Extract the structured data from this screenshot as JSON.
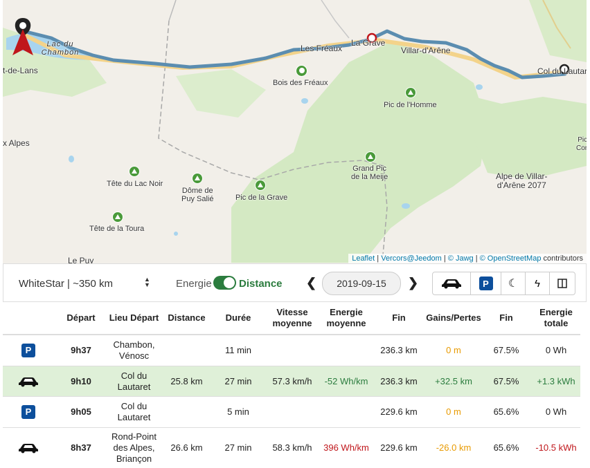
{
  "map": {
    "towns": {
      "chambon": "Lac du Chambon",
      "lans": "t-de-Lans",
      "lesfreaux": "Les Fréaux",
      "lagrave": "La Grave",
      "villar": "Villar-d'Arêne",
      "col": "Col du Lautar",
      "alpes": "x Alpes",
      "lepuy": "Le Puy",
      "picright": "Pic\nCon"
    },
    "peaks": {
      "bois": "Bois des Fréaux",
      "homme": "Pic de l'Homme",
      "meije": "Grand Pic\nde la Meije",
      "lacnoir": "Tête du Lac Noir",
      "puysalie": "Dôme de\nPuy Salié",
      "grave": "Pic de la Grave",
      "toura": "Tête de la Toura",
      "alpe": "Alpe de Villar-\nd'Arêne 2077"
    },
    "attribution": {
      "leaflet": "Leaflet",
      "vercors": "Vercors@Jeedom",
      "jawg": "© Jawg",
      "osm": "© OpenStreetMap",
      "contributors": "contributors"
    }
  },
  "controls": {
    "vehicle": "WhiteStar | ~350 km",
    "energie_label": "Energie",
    "distance_label": "Distance",
    "date": "2019-09-15",
    "buttons": [
      "car-icon",
      "parking-icon",
      "moon-icon",
      "bolt-icon",
      "columns-icon"
    ]
  },
  "table": {
    "headers": [
      "",
      "Départ",
      "Lieu Départ",
      "Distance",
      "Durée",
      "Vitesse moyenne",
      "Energie moyenne",
      "Fin",
      "Gains/Pertes",
      "Fin",
      "Energie totale"
    ],
    "rows": [
      {
        "type": "parking",
        "depart": "9h37",
        "lieu": "Chambon, Vénosc",
        "distance": "",
        "duree": "11 min",
        "vitesse": "",
        "energie": "",
        "fin": "236.3 km",
        "gains": "0 m",
        "fin2": "67.5%",
        "total": "0 Wh"
      },
      {
        "type": "drive",
        "depart": "9h10",
        "lieu": "Col du Lautaret",
        "distance": "25.8 km",
        "duree": "27 min",
        "vitesse": "57.3 km/h",
        "energie": "-52 Wh/km",
        "fin": "236.3 km",
        "gains": "+32.5 km",
        "fin2": "67.5%",
        "total": "+1.3 kWh"
      },
      {
        "type": "parking",
        "depart": "9h05",
        "lieu": "Col du Lautaret",
        "distance": "",
        "duree": "5 min",
        "vitesse": "",
        "energie": "",
        "fin": "229.6 km",
        "gains": "0 m",
        "fin2": "65.6%",
        "total": "0 Wh"
      },
      {
        "type": "drive",
        "depart": "8h37",
        "lieu": "Rond-Point des Alpes, Briançon",
        "distance": "26.6 km",
        "duree": "27 min",
        "vitesse": "58.3 km/h",
        "energie": "396 Wh/km",
        "fin": "229.6 km",
        "gains": "-26.0 km",
        "fin2": "65.6%",
        "total": "-10.5 kWh"
      }
    ]
  },
  "colors": {
    "accent_green": "#2b7c3e",
    "parking_blue": "#0d4f9c",
    "route": "#5b8db0",
    "highlight": "#dff0d8"
  }
}
